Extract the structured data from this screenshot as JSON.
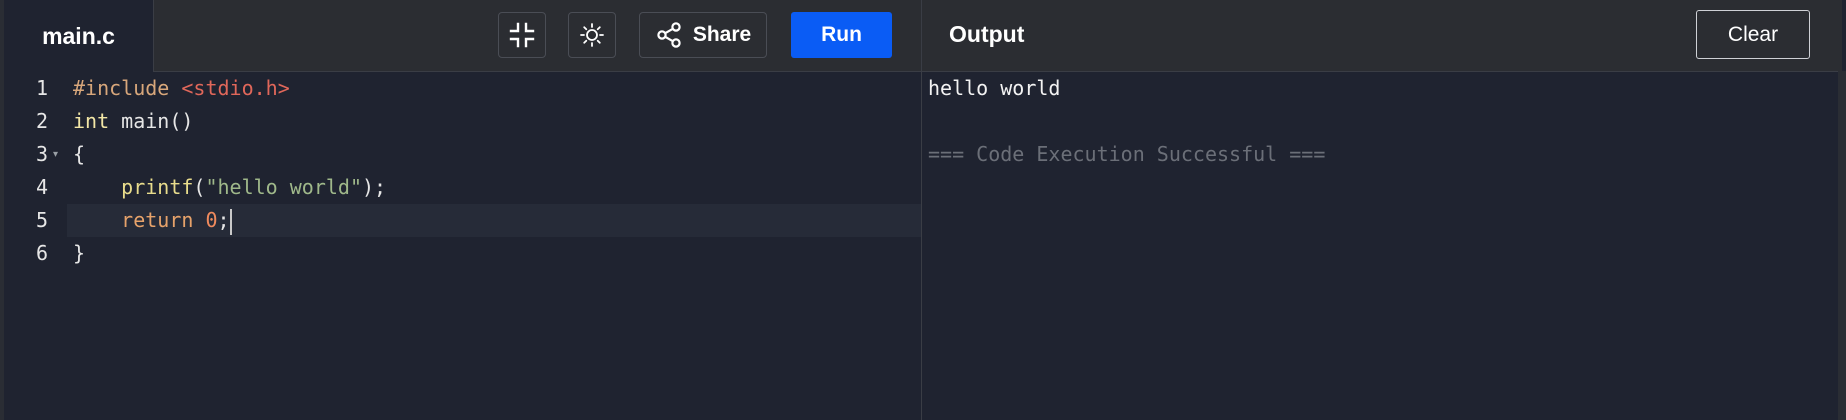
{
  "editor": {
    "file_tab": "main.c",
    "lines": [
      {
        "num": "1",
        "parts": [
          {
            "t": "#include ",
            "c": "c-pre"
          },
          {
            "t": "<stdio.h>",
            "c": "c-inc"
          }
        ]
      },
      {
        "num": "2",
        "parts": [
          {
            "t": "int",
            "c": "c-kw"
          },
          {
            "t": " main()",
            "c": ""
          }
        ]
      },
      {
        "num": "3",
        "parts": [
          {
            "t": "{",
            "c": ""
          }
        ],
        "fold": true
      },
      {
        "num": "4",
        "parts": [
          {
            "t": "    ",
            "c": ""
          },
          {
            "t": "printf",
            "c": "c-fn"
          },
          {
            "t": "(",
            "c": ""
          },
          {
            "t": "\"hello world\"",
            "c": "c-str"
          },
          {
            "t": ");",
            "c": ""
          }
        ]
      },
      {
        "num": "5",
        "parts": [
          {
            "t": "    ",
            "c": ""
          },
          {
            "t": "return",
            "c": "c-ret"
          },
          {
            "t": " ",
            "c": ""
          },
          {
            "t": "0",
            "c": "c-num"
          },
          {
            "t": ";",
            "c": ""
          }
        ],
        "active": true
      },
      {
        "num": "6",
        "parts": [
          {
            "t": "}",
            "c": ""
          }
        ]
      }
    ]
  },
  "toolbar": {
    "share_label": "Share",
    "run_label": "Run",
    "fullscreen_icon": "exit-fullscreen-icon",
    "theme_icon": "sun-icon",
    "share_icon": "share-icon"
  },
  "output": {
    "title": "Output",
    "clear_label": "Clear",
    "lines": [
      "hello world",
      "",
      "=== Code Execution Successful ==="
    ]
  },
  "colors": {
    "run_button": "#0a5cf5",
    "editor_bg": "#1f2330",
    "topbar_bg": "#2b2d32",
    "active_line": "#262b38"
  }
}
